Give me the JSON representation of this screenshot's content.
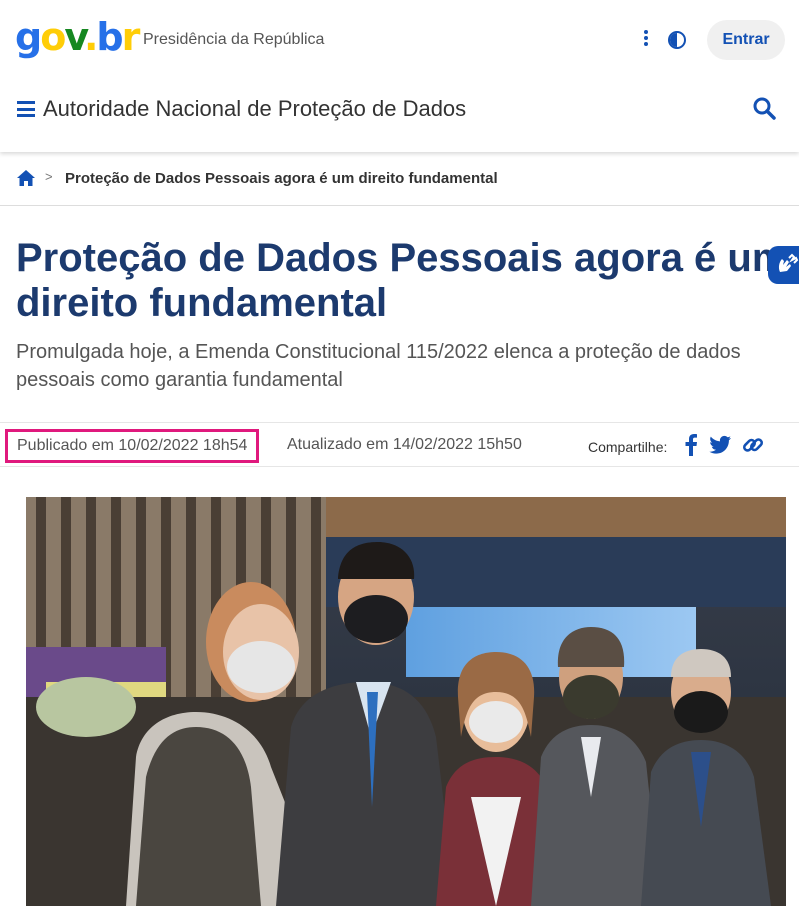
{
  "header": {
    "logo": {
      "g": "g",
      "o": "o",
      "v": "v",
      "dot": ".",
      "b": "b",
      "r": "r"
    },
    "org": "Presidência da República",
    "login_label": "Entrar",
    "site_title": "Autoridade Nacional de Proteção de Dados"
  },
  "breadcrumb": {
    "separator": ">",
    "current": "Proteção de Dados Pessoais agora é um direito fundamental"
  },
  "article": {
    "title": "Proteção de Dados Pessoais agora é um direito fundamental",
    "subtitle": "Promulgada hoje, a Emenda Constitucional 115/2022 elenca a proteção de dados pessoais como garantia fundamental",
    "published": "Publicado em 10/02/2022 18h54",
    "updated": "Atualizado em 14/02/2022 15h50",
    "share_label": "Compartilhe:"
  },
  "icons": {
    "menu": "menu-icon",
    "search": "search-icon",
    "home": "home-icon",
    "facebook": "facebook-icon",
    "twitter": "twitter-icon",
    "link": "link-icon",
    "kebab": "kebab-icon",
    "contrast": "contrast-icon",
    "libras": "libras-hands-icon"
  },
  "colors": {
    "primary": "#1351b4",
    "title": "#1c3a6e",
    "highlight": "#e0197d"
  }
}
